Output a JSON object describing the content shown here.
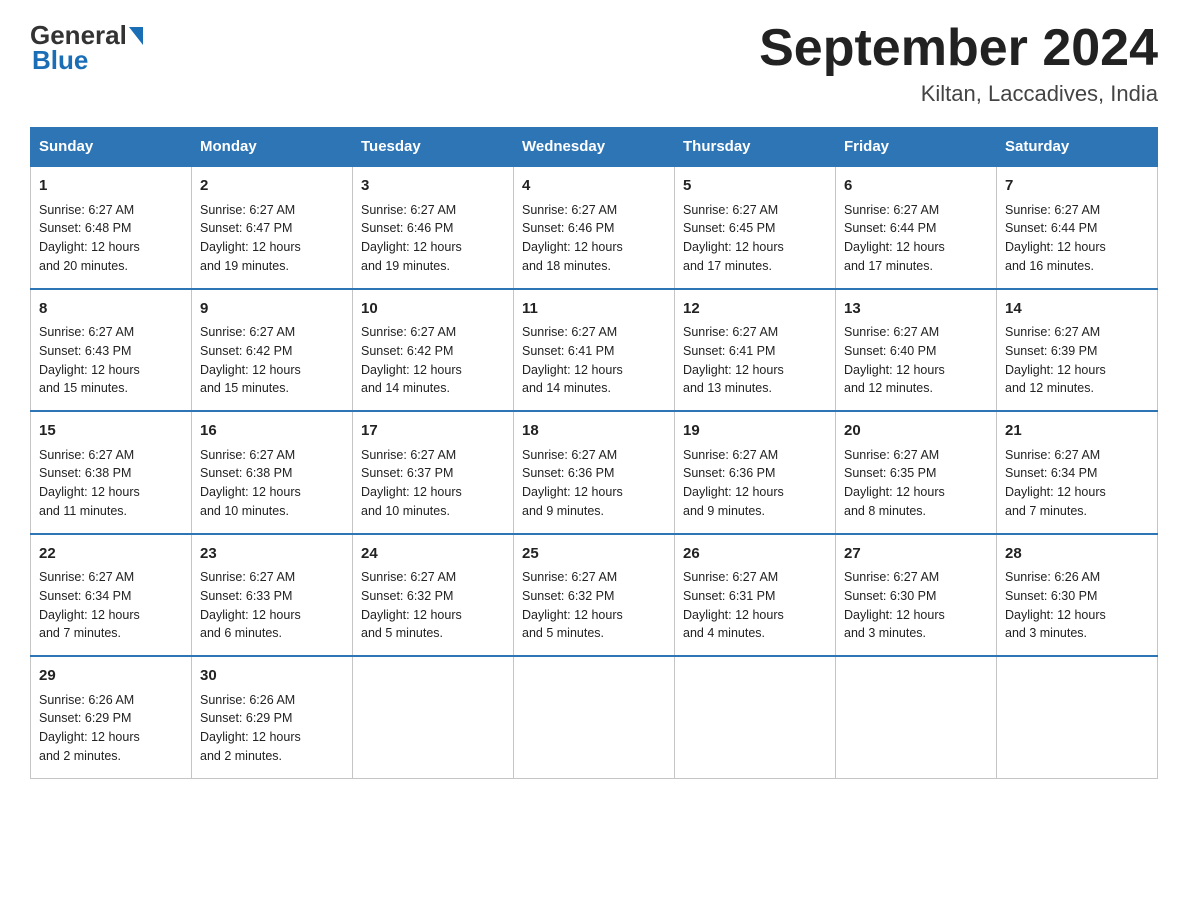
{
  "header": {
    "logo_general": "General",
    "logo_blue": "Blue",
    "title": "September 2024",
    "subtitle": "Kiltan, Laccadives, India"
  },
  "days_of_week": [
    "Sunday",
    "Monday",
    "Tuesday",
    "Wednesday",
    "Thursday",
    "Friday",
    "Saturday"
  ],
  "weeks": [
    [
      {
        "day": "1",
        "sunrise": "6:27 AM",
        "sunset": "6:48 PM",
        "daylight": "12 hours and 20 minutes."
      },
      {
        "day": "2",
        "sunrise": "6:27 AM",
        "sunset": "6:47 PM",
        "daylight": "12 hours and 19 minutes."
      },
      {
        "day": "3",
        "sunrise": "6:27 AM",
        "sunset": "6:46 PM",
        "daylight": "12 hours and 19 minutes."
      },
      {
        "day": "4",
        "sunrise": "6:27 AM",
        "sunset": "6:46 PM",
        "daylight": "12 hours and 18 minutes."
      },
      {
        "day": "5",
        "sunrise": "6:27 AM",
        "sunset": "6:45 PM",
        "daylight": "12 hours and 17 minutes."
      },
      {
        "day": "6",
        "sunrise": "6:27 AM",
        "sunset": "6:44 PM",
        "daylight": "12 hours and 17 minutes."
      },
      {
        "day": "7",
        "sunrise": "6:27 AM",
        "sunset": "6:44 PM",
        "daylight": "12 hours and 16 minutes."
      }
    ],
    [
      {
        "day": "8",
        "sunrise": "6:27 AM",
        "sunset": "6:43 PM",
        "daylight": "12 hours and 15 minutes."
      },
      {
        "day": "9",
        "sunrise": "6:27 AM",
        "sunset": "6:42 PM",
        "daylight": "12 hours and 15 minutes."
      },
      {
        "day": "10",
        "sunrise": "6:27 AM",
        "sunset": "6:42 PM",
        "daylight": "12 hours and 14 minutes."
      },
      {
        "day": "11",
        "sunrise": "6:27 AM",
        "sunset": "6:41 PM",
        "daylight": "12 hours and 14 minutes."
      },
      {
        "day": "12",
        "sunrise": "6:27 AM",
        "sunset": "6:41 PM",
        "daylight": "12 hours and 13 minutes."
      },
      {
        "day": "13",
        "sunrise": "6:27 AM",
        "sunset": "6:40 PM",
        "daylight": "12 hours and 12 minutes."
      },
      {
        "day": "14",
        "sunrise": "6:27 AM",
        "sunset": "6:39 PM",
        "daylight": "12 hours and 12 minutes."
      }
    ],
    [
      {
        "day": "15",
        "sunrise": "6:27 AM",
        "sunset": "6:38 PM",
        "daylight": "12 hours and 11 minutes."
      },
      {
        "day": "16",
        "sunrise": "6:27 AM",
        "sunset": "6:38 PM",
        "daylight": "12 hours and 10 minutes."
      },
      {
        "day": "17",
        "sunrise": "6:27 AM",
        "sunset": "6:37 PM",
        "daylight": "12 hours and 10 minutes."
      },
      {
        "day": "18",
        "sunrise": "6:27 AM",
        "sunset": "6:36 PM",
        "daylight": "12 hours and 9 minutes."
      },
      {
        "day": "19",
        "sunrise": "6:27 AM",
        "sunset": "6:36 PM",
        "daylight": "12 hours and 9 minutes."
      },
      {
        "day": "20",
        "sunrise": "6:27 AM",
        "sunset": "6:35 PM",
        "daylight": "12 hours and 8 minutes."
      },
      {
        "day": "21",
        "sunrise": "6:27 AM",
        "sunset": "6:34 PM",
        "daylight": "12 hours and 7 minutes."
      }
    ],
    [
      {
        "day": "22",
        "sunrise": "6:27 AM",
        "sunset": "6:34 PM",
        "daylight": "12 hours and 7 minutes."
      },
      {
        "day": "23",
        "sunrise": "6:27 AM",
        "sunset": "6:33 PM",
        "daylight": "12 hours and 6 minutes."
      },
      {
        "day": "24",
        "sunrise": "6:27 AM",
        "sunset": "6:32 PM",
        "daylight": "12 hours and 5 minutes."
      },
      {
        "day": "25",
        "sunrise": "6:27 AM",
        "sunset": "6:32 PM",
        "daylight": "12 hours and 5 minutes."
      },
      {
        "day": "26",
        "sunrise": "6:27 AM",
        "sunset": "6:31 PM",
        "daylight": "12 hours and 4 minutes."
      },
      {
        "day": "27",
        "sunrise": "6:27 AM",
        "sunset": "6:30 PM",
        "daylight": "12 hours and 3 minutes."
      },
      {
        "day": "28",
        "sunrise": "6:26 AM",
        "sunset": "6:30 PM",
        "daylight": "12 hours and 3 minutes."
      }
    ],
    [
      {
        "day": "29",
        "sunrise": "6:26 AM",
        "sunset": "6:29 PM",
        "daylight": "12 hours and 2 minutes."
      },
      {
        "day": "30",
        "sunrise": "6:26 AM",
        "sunset": "6:29 PM",
        "daylight": "12 hours and 2 minutes."
      },
      null,
      null,
      null,
      null,
      null
    ]
  ]
}
